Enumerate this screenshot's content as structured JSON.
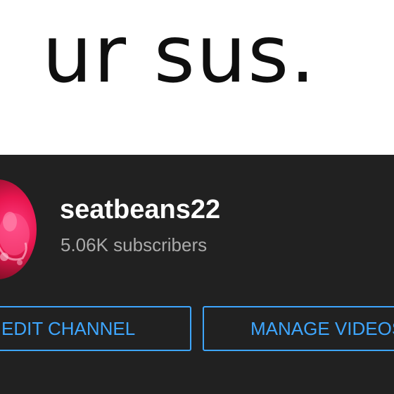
{
  "banner": {
    "text": "ur sus."
  },
  "channel": {
    "name": "seatbeans22",
    "subscribers": "5.06K subscribers",
    "avatar_icon": "channel-avatar"
  },
  "actions": {
    "edit_label": "EDIT CHANNEL",
    "manage_label": "MANAGE VIDEOS"
  },
  "colors": {
    "panel_background": "#212121",
    "accent_blue": "#3ea6ff",
    "secondary_text": "#aaaaaa",
    "avatar_pink": "#e8164f"
  }
}
